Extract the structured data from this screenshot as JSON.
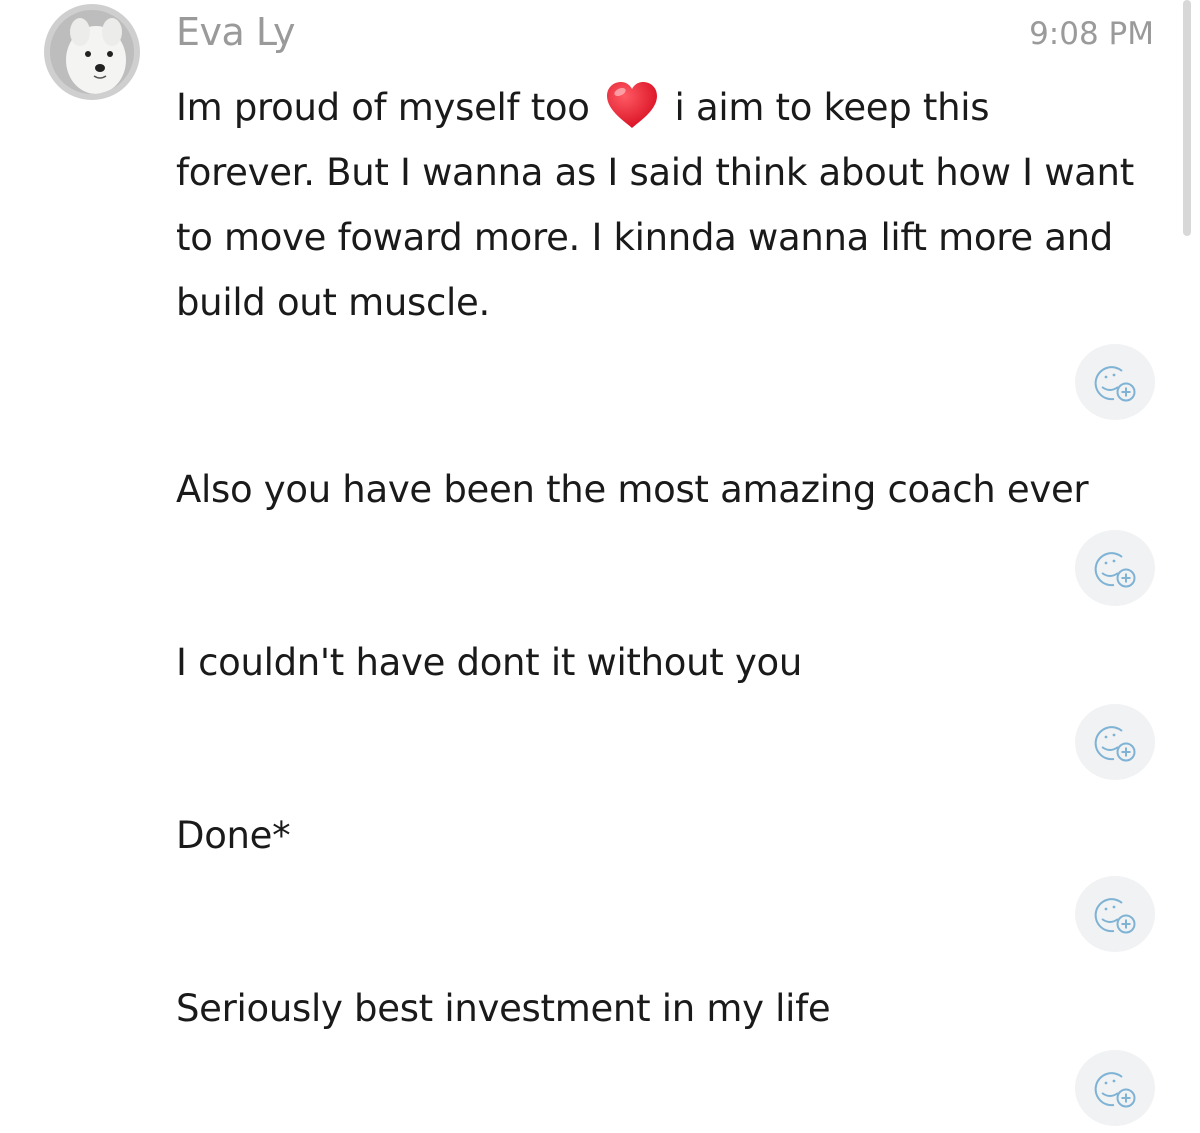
{
  "message": {
    "sender_name": "Eva Ly",
    "timestamp": "9:08 PM",
    "first_text_before_emoji": "Im proud of myself too",
    "emoji": "heart-emoji",
    "first_text_after_emoji": "i aim to keep this forever. But I wanna as I said think about how I want to move foward more. I kinnda wanna lift more and build out muscle."
  },
  "followups": [
    {
      "text": "Also you have been the most amazing coach ever"
    },
    {
      "text": "I couldn't have dont it without you"
    },
    {
      "text": "Done*"
    },
    {
      "text": "Seriously best investment in my life"
    }
  ],
  "reaction_icon": "add-reaction-icon",
  "colors": {
    "meta_text": "#9a9a9a",
    "message_text": "#1a1a1a",
    "reaction_bg": "#f1f2f3",
    "reaction_icon": "#7fb3d5",
    "heart": "#e0142b"
  }
}
